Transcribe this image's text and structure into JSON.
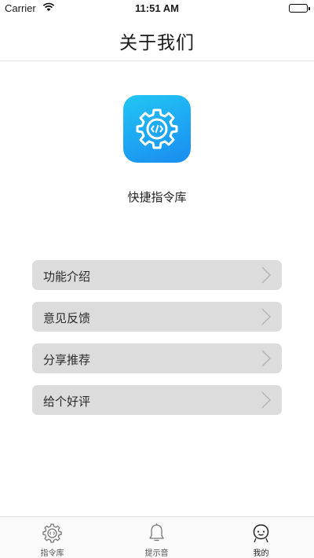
{
  "status_bar": {
    "carrier": "Carrier",
    "time": "11:51 AM"
  },
  "nav": {
    "title": "关于我们"
  },
  "app": {
    "name": "快捷指令库",
    "icon": "gear-code-icon"
  },
  "menu": {
    "items": [
      {
        "label": "功能介绍"
      },
      {
        "label": "意见反馈"
      },
      {
        "label": "分享推荐"
      },
      {
        "label": "给个好评"
      }
    ]
  },
  "tabs": [
    {
      "label": "指令库",
      "icon": "gear-code-icon"
    },
    {
      "label": "提示音",
      "icon": "bell-icon"
    },
    {
      "label": "我的",
      "icon": "face-icon",
      "active": true
    }
  ],
  "colors": {
    "accent_start": "#22c6f5",
    "accent_end": "#1a8cf0",
    "menu_bg": "#dcdcdc"
  }
}
